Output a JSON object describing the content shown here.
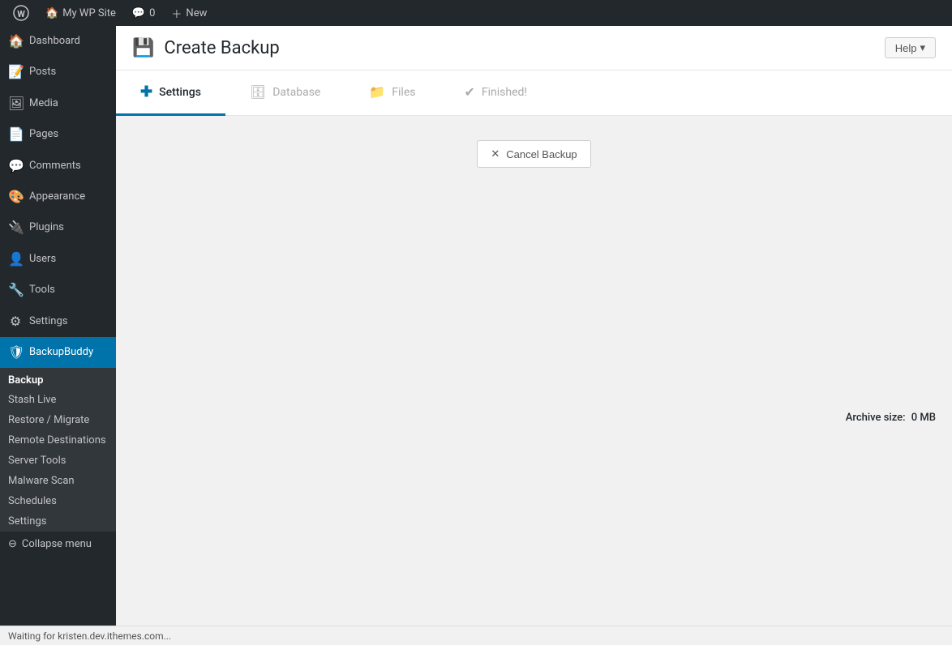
{
  "adminBar": {
    "wpLogoAlt": "WordPress",
    "siteName": "My WP Site",
    "commentsLabel": "0",
    "newLabel": "New"
  },
  "sidebar": {
    "items": [
      {
        "id": "dashboard",
        "label": "Dashboard",
        "icon": "🏠"
      },
      {
        "id": "posts",
        "label": "Posts",
        "icon": "📝"
      },
      {
        "id": "media",
        "label": "Media",
        "icon": "🖼"
      },
      {
        "id": "pages",
        "label": "Pages",
        "icon": "📄"
      },
      {
        "id": "comments",
        "label": "Comments",
        "icon": "💬"
      },
      {
        "id": "appearance",
        "label": "Appearance",
        "icon": "🎨"
      },
      {
        "id": "plugins",
        "label": "Plugins",
        "icon": "🔌"
      },
      {
        "id": "users",
        "label": "Users",
        "icon": "👤"
      },
      {
        "id": "tools",
        "label": "Tools",
        "icon": "🔧"
      },
      {
        "id": "settings",
        "label": "Settings",
        "icon": "⚙"
      },
      {
        "id": "backupbuddy",
        "label": "BackupBuddy",
        "icon": "🛡"
      }
    ],
    "backupBuddySubmenu": {
      "sectionLabel": "Backup",
      "items": [
        {
          "id": "stash-live",
          "label": "Stash Live"
        },
        {
          "id": "restore-migrate",
          "label": "Restore / Migrate"
        },
        {
          "id": "remote-destinations",
          "label": "Remote Destinations"
        },
        {
          "id": "server-tools",
          "label": "Server Tools"
        },
        {
          "id": "malware-scan",
          "label": "Malware Scan"
        },
        {
          "id": "schedules",
          "label": "Schedules"
        },
        {
          "id": "settings-sub",
          "label": "Settings"
        }
      ]
    },
    "collapseMenu": "Collapse menu"
  },
  "page": {
    "titleIcon": "💾",
    "title": "Create Backup",
    "helpButton": "Help"
  },
  "tabs": [
    {
      "id": "settings",
      "label": "Settings",
      "icon": "✚",
      "active": true
    },
    {
      "id": "database",
      "label": "Database",
      "icon": "🗄",
      "active": false
    },
    {
      "id": "files",
      "label": "Files",
      "icon": "📁",
      "active": false
    },
    {
      "id": "finished",
      "label": "Finished!",
      "icon": "✔",
      "active": false
    }
  ],
  "content": {
    "cancelButton": "Cancel Backup",
    "archiveSizeLabel": "Archive size:",
    "archiveSizeValue": "0 MB"
  },
  "statusBar": {
    "text": "Waiting for kristen.dev.ithemes.com..."
  }
}
